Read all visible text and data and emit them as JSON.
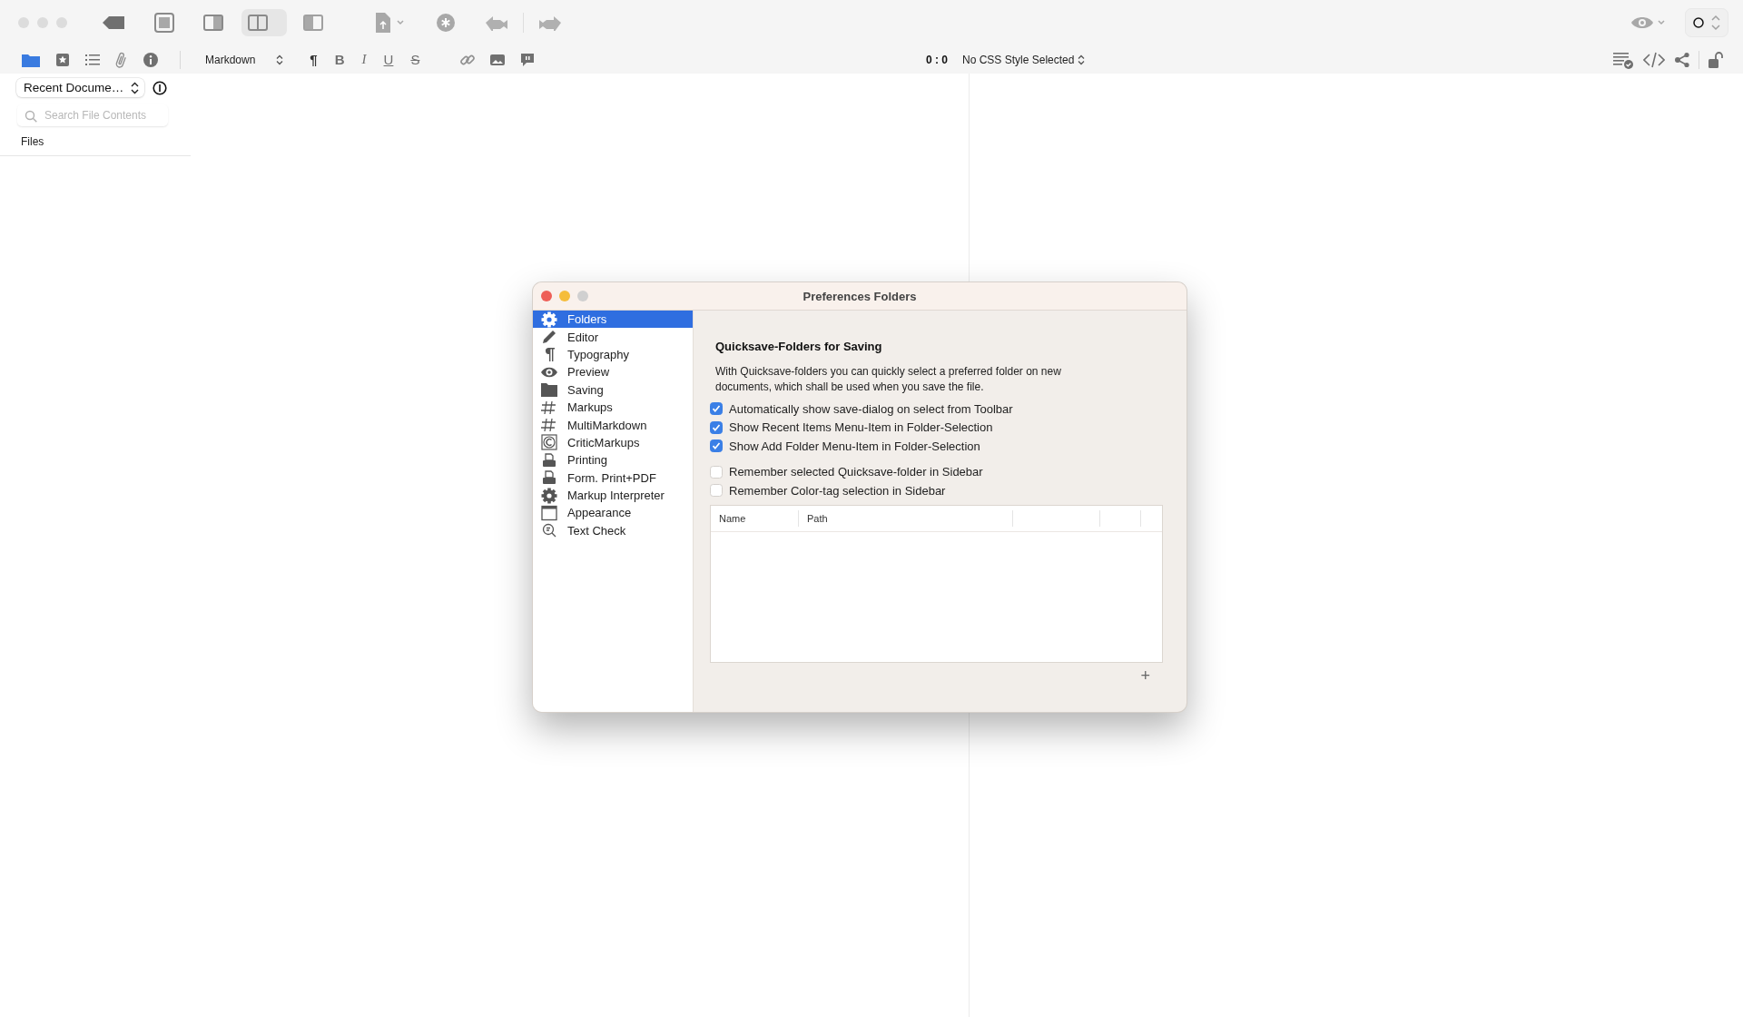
{
  "toolbar": {
    "format_menu": "Markdown",
    "format_buttons": [
      {
        "label": "¶",
        "kind": "plain"
      },
      {
        "label": "B",
        "kind": "bold"
      },
      {
        "label": "I",
        "kind": "italic"
      },
      {
        "label": "U",
        "kind": "underline"
      },
      {
        "label": "S",
        "kind": "strike"
      }
    ],
    "cursor_position": "0 : 0",
    "css_menu": "No CSS Style Selected"
  },
  "sidebar": {
    "documents_menu": "Recent Docume…",
    "search": {
      "placeholder": "Search File Contents"
    },
    "section": "Files"
  },
  "preferences": {
    "title": "Preferences Folders",
    "categories": [
      {
        "label": "Folders",
        "selected": true
      },
      {
        "label": "Editor",
        "selected": false
      },
      {
        "label": "Typography",
        "selected": false
      },
      {
        "label": "Preview",
        "selected": false
      },
      {
        "label": "Saving",
        "selected": false
      },
      {
        "label": "Markups",
        "selected": false
      },
      {
        "label": "MultiMarkdown",
        "selected": false
      },
      {
        "label": "CriticMarkups",
        "selected": false
      },
      {
        "label": "Printing",
        "selected": false
      },
      {
        "label": "Form. Print+PDF",
        "selected": false
      },
      {
        "label": "Markup Interpreter",
        "selected": false
      },
      {
        "label": "Appearance",
        "selected": false
      },
      {
        "label": "Text Check",
        "selected": false
      }
    ],
    "heading": "Quicksave-Folders for Saving",
    "description": "With Quicksave-folders you can quickly select a preferred folder on new documents, which shall be used when you save the file.",
    "option_groups": [
      {
        "options": [
          {
            "label": "Automatically show save-dialog on select from Toolbar",
            "checked": true
          },
          {
            "label": "Show Recent Items Menu-Item in Folder-Selection",
            "checked": true
          },
          {
            "label": "Show Add Folder Menu-Item in Folder-Selection",
            "checked": true
          }
        ]
      },
      {
        "options": [
          {
            "label": "Remember selected Quicksave-folder in Sidebar",
            "checked": false
          },
          {
            "label": "Remember Color-tag selection in Sidebar",
            "checked": false
          }
        ]
      }
    ],
    "table": {
      "columns": [
        "Name",
        "Path"
      ]
    },
    "add_button": "+"
  }
}
